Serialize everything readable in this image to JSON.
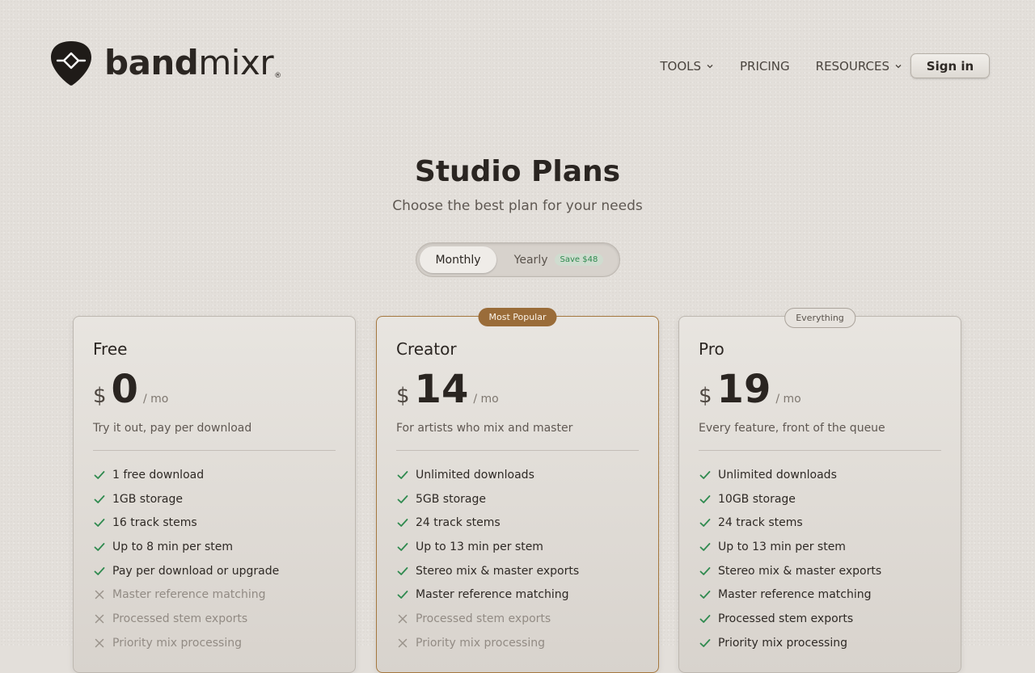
{
  "brand": {
    "name_bold": "band",
    "name_light": "mixr",
    "registered": "®",
    "accent": "#2b2622"
  },
  "nav": {
    "items": [
      {
        "label": "TOOLS",
        "has_dropdown": true
      },
      {
        "label": "PRICING",
        "has_dropdown": false
      },
      {
        "label": "RESOURCES",
        "has_dropdown": true
      }
    ],
    "signin_label": "Sign in"
  },
  "hero": {
    "title": "Studio Plans",
    "subtitle": "Choose the best plan for your needs"
  },
  "billing_toggle": {
    "monthly_label": "Monthly",
    "yearly_label": "Yearly",
    "yearly_badge": "Save $48",
    "selected": "Monthly"
  },
  "colors": {
    "check": "#2f8a4f",
    "cross": "#9a938b",
    "popular_badge": "#9a6c39"
  },
  "plans": [
    {
      "name": "Free",
      "currency": "$",
      "price": "0",
      "period": "/ mo",
      "description": "Try it out, pay per download",
      "badge": "",
      "features": [
        {
          "text": "1 free download",
          "included": true
        },
        {
          "text": "1GB storage",
          "included": true
        },
        {
          "text": "16 track stems",
          "included": true
        },
        {
          "text": "Up to 8 min per stem",
          "included": true
        },
        {
          "text": "Pay per download or upgrade",
          "included": true
        },
        {
          "text": "Master reference matching",
          "included": false
        },
        {
          "text": "Processed stem exports",
          "included": false
        },
        {
          "text": "Priority mix processing",
          "included": false
        }
      ]
    },
    {
      "name": "Creator",
      "currency": "$",
      "price": "14",
      "period": "/ mo",
      "description": "For artists who mix and master",
      "badge": "Most Popular",
      "features": [
        {
          "text": "Unlimited downloads",
          "included": true
        },
        {
          "text": "5GB storage",
          "included": true
        },
        {
          "text": "24 track stems",
          "included": true
        },
        {
          "text": "Up to 13 min per stem",
          "included": true
        },
        {
          "text": "Stereo mix & master exports",
          "included": true
        },
        {
          "text": "Master reference matching",
          "included": true
        },
        {
          "text": "Processed stem exports",
          "included": false
        },
        {
          "text": "Priority mix processing",
          "included": false
        }
      ]
    },
    {
      "name": "Pro",
      "currency": "$",
      "price": "19",
      "period": "/ mo",
      "description": "Every feature, front of the queue",
      "badge": "Everything",
      "features": [
        {
          "text": "Unlimited downloads",
          "included": true
        },
        {
          "text": "10GB storage",
          "included": true
        },
        {
          "text": "24 track stems",
          "included": true
        },
        {
          "text": "Up to 13 min per stem",
          "included": true
        },
        {
          "text": "Stereo mix & master exports",
          "included": true
        },
        {
          "text": "Master reference matching",
          "included": true
        },
        {
          "text": "Processed stem exports",
          "included": true
        },
        {
          "text": "Priority mix processing",
          "included": true
        }
      ]
    }
  ]
}
